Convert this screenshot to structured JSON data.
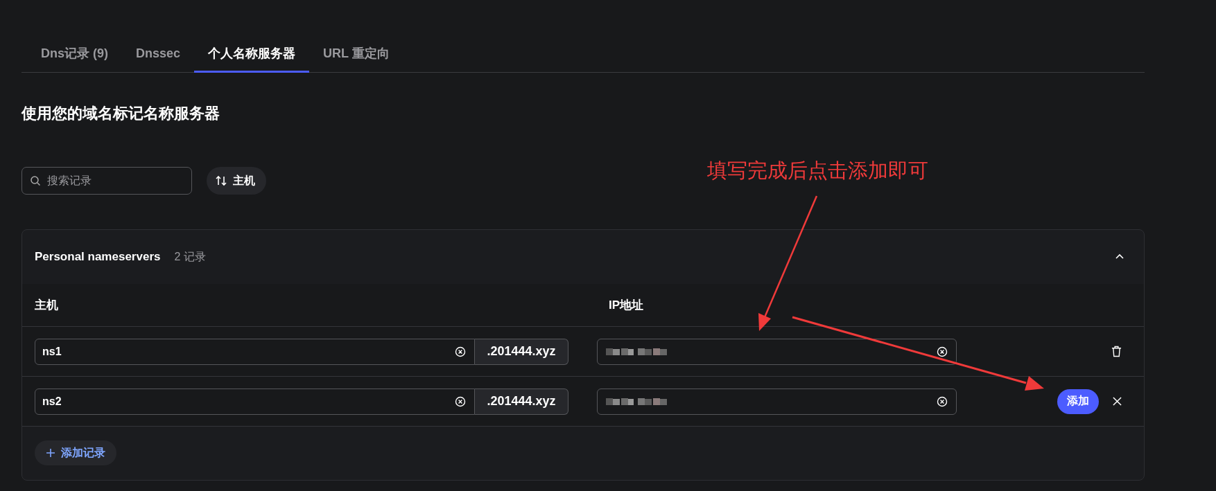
{
  "tabs": [
    {
      "label": "Dns记录 (9)",
      "selected": false
    },
    {
      "label": "Dnssec",
      "selected": false
    },
    {
      "label": "个人名称服务器",
      "selected": true
    },
    {
      "label": "URL 重定向",
      "selected": false
    }
  ],
  "heading": "使用您的域名标记名称服务器",
  "search": {
    "placeholder": "搜索记录"
  },
  "sort_button": {
    "label": "主机"
  },
  "card": {
    "title": "Personal nameservers",
    "count": "2 记录",
    "expanded": true,
    "columns": [
      "主机",
      "IP地址"
    ],
    "rows": [
      {
        "kind": "saved",
        "host": "ns1",
        "suffix": ".201444.xyz"
      },
      {
        "kind": "new",
        "host": "ns2",
        "suffix": ".201444.xyz",
        "add_label": "添加"
      }
    ],
    "add_record": "添加记录"
  },
  "annotation": {
    "text": "填写完成后点击添加即可"
  }
}
